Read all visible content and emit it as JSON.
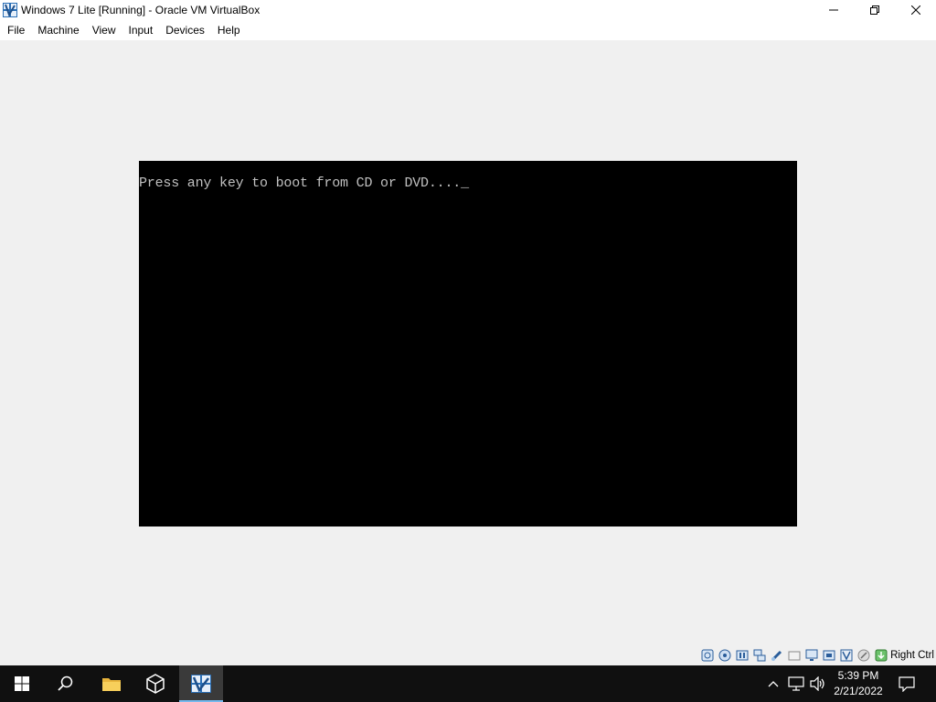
{
  "window": {
    "title": "Windows 7 Lite [Running] - Oracle VM VirtualBox"
  },
  "menu": {
    "items": [
      "File",
      "Machine",
      "View",
      "Input",
      "Devices",
      "Help"
    ]
  },
  "vm_console": {
    "text": "Press any key to boot from CD or DVD....",
    "cursor": "_"
  },
  "statusbar": {
    "icons": [
      "hard-disk-icon",
      "optical-drive-icon",
      "audio-icon",
      "network-icon",
      "usb-icon",
      "shared-folders-icon",
      "display-icon",
      "video-capture-icon",
      "cpu-icon",
      "mouse-integration-icon",
      "host-key-icon"
    ],
    "host_key_label": "Right Ctrl"
  },
  "taskbar": {
    "clock_time": "5:39 PM",
    "clock_date": "2/21/2022"
  }
}
